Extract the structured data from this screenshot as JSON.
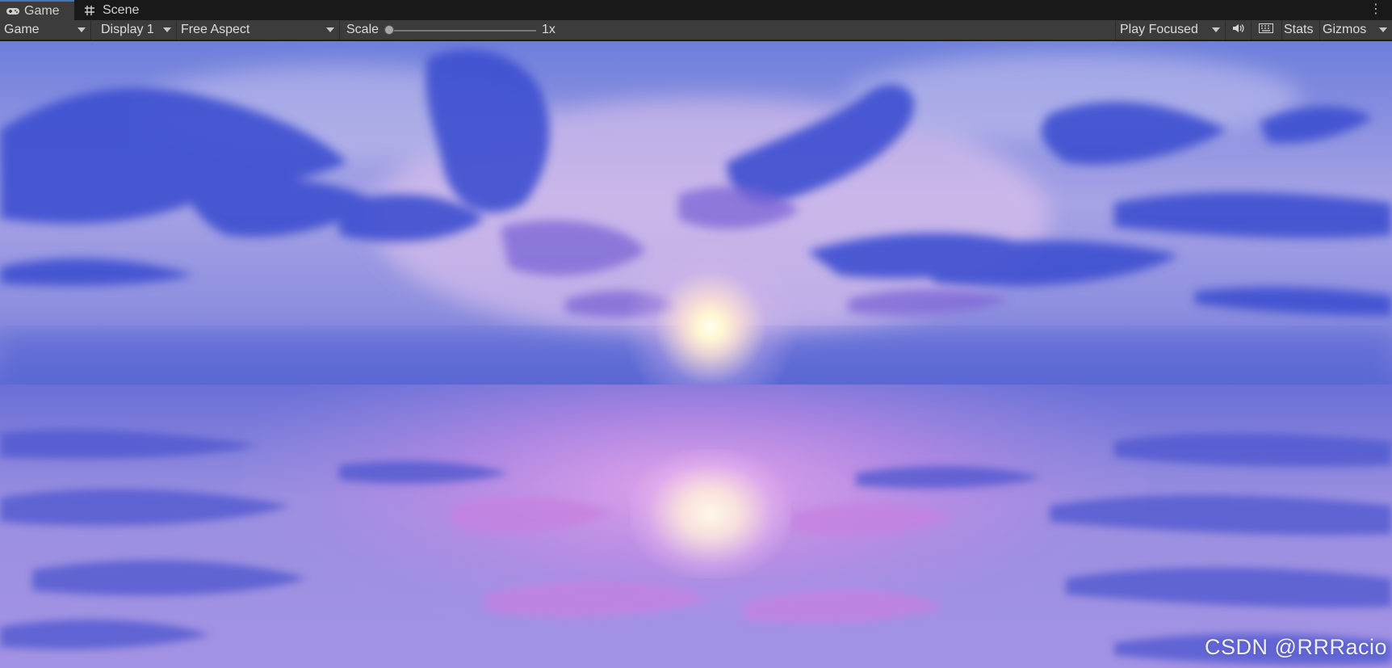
{
  "tabs": [
    {
      "label": "Game",
      "icon": "gamepad-icon",
      "active": true
    },
    {
      "label": "Scene",
      "icon": "hash-grid-icon",
      "active": false
    }
  ],
  "toolbar": {
    "view_select": "Game",
    "display_select": "Display 1",
    "aspect_select": "Free Aspect",
    "scale_label": "Scale",
    "scale_value": "1x",
    "scale_slider_level": 0.0,
    "play_mode_select": "Play Focused",
    "mute_icon": "speaker-icon",
    "keyboard_icon": "keyboard-icon",
    "stats_label": "Stats",
    "gizmos_label": "Gizmos"
  },
  "viewport": {
    "description_colors": {
      "sky_top": "#6f7fd9",
      "horizon": "#5f6fd6",
      "sun": "#fffdf0",
      "sea_highlight": "#d8a0e8"
    }
  },
  "watermark": "CSDN @RRRacio"
}
